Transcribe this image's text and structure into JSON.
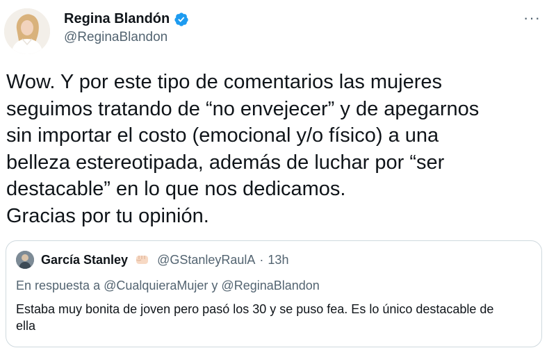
{
  "author": {
    "display_name": "Regina Blandón",
    "handle": "@ReginaBlandon",
    "verified": true,
    "avatar_icon": "profile-photo"
  },
  "more_menu": {
    "label": "···"
  },
  "tweet": {
    "text": "Wow. Y por este tipo de comentarios las mujeres\nseguimos tratando de “no envejecer” y de apegarnos\nsin importar el costo (emocional y/o físico) a una\nbelleza estereotipada, además de luchar por “ser\ndestacable” en lo que nos dedicamos.\nGracias por tu opinión."
  },
  "quoted": {
    "display_name": "García Stanley",
    "emoji_icon": "fist-emoji",
    "handle": "@GStanleyRaulA",
    "dot": "·",
    "time": "13h",
    "reply_to": "En respuesta a @CualquieraMujer y @ReginaBlandon",
    "text": "Estaba muy bonita de joven pero pasó los 30 y se puso fea. Es lo único destacable de ella"
  },
  "colors": {
    "text": "#0f1419",
    "secondary": "#536471",
    "verified": "#1d9bf0",
    "border": "#cfd9de"
  }
}
